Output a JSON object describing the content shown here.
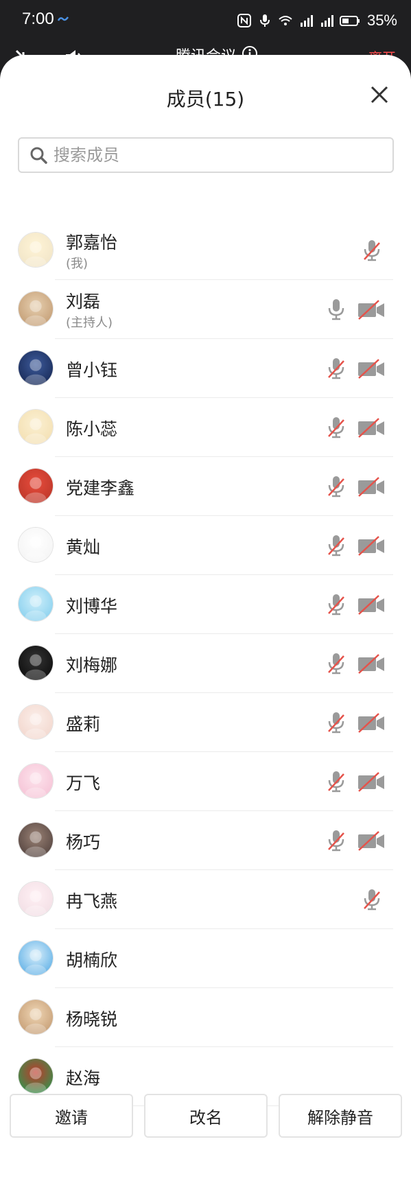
{
  "status_bar": {
    "time": "7:00",
    "battery_percent": "35%",
    "icons": [
      "cloud-sync-icon",
      "nfc-icon",
      "mic-status-icon",
      "wifi-icon",
      "signal-4g-icon",
      "signal-4g-icon",
      "battery-icon"
    ]
  },
  "behind_header": {
    "title": "腾讯会议",
    "right_label": "离开"
  },
  "panel": {
    "title": "成员(15)",
    "close_icon": "close-icon"
  },
  "search": {
    "placeholder": "搜索成员",
    "value": ""
  },
  "members": [
    {
      "name": "郭嘉怡",
      "sub": "(我)",
      "mic": "muted",
      "camera": "none"
    },
    {
      "name": "刘磊",
      "sub": "(主持人)",
      "mic": "on",
      "camera": "off"
    },
    {
      "name": "曾小钰",
      "sub": "",
      "mic": "muted",
      "camera": "off"
    },
    {
      "name": "陈小蕊",
      "sub": "",
      "mic": "muted",
      "camera": "off"
    },
    {
      "name": "党建李鑫",
      "sub": "",
      "mic": "muted",
      "camera": "off"
    },
    {
      "name": "黄灿",
      "sub": "",
      "mic": "muted",
      "camera": "off"
    },
    {
      "name": "刘博华",
      "sub": "",
      "mic": "muted",
      "camera": "off"
    },
    {
      "name": "刘梅娜",
      "sub": "",
      "mic": "muted",
      "camera": "off"
    },
    {
      "name": "盛莉",
      "sub": "",
      "mic": "muted",
      "camera": "off"
    },
    {
      "name": "万飞",
      "sub": "",
      "mic": "muted",
      "camera": "off"
    },
    {
      "name": "杨巧",
      "sub": "",
      "mic": "muted",
      "camera": "off"
    },
    {
      "name": "冉飞燕",
      "sub": "",
      "mic": "muted",
      "camera": "none"
    },
    {
      "name": "胡楠欣",
      "sub": "",
      "mic": "none",
      "camera": "none"
    },
    {
      "name": "杨晓锐",
      "sub": "",
      "mic": "none",
      "camera": "none"
    },
    {
      "name": "赵海",
      "sub": "",
      "mic": "none",
      "camera": "none"
    }
  ],
  "footer": {
    "invite_label": "邀请",
    "rename_label": "改名",
    "unmute_label": "解除静音"
  },
  "colors": {
    "accent_red": "#e5534b",
    "icon_gray": "#9a9a9a",
    "text_dark": "#222222",
    "divider": "#ebebeb"
  }
}
